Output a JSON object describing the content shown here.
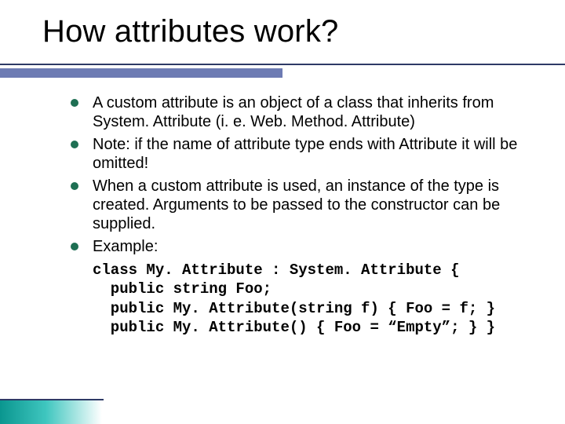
{
  "title": "How attributes work?",
  "bullets": [
    "A custom attribute is an object of a class that inherits from System. Attribute (i. e. Web. Method. Attribute)",
    "Note: if the name of attribute type ends with Attribute it will be omitted!",
    "When a custom attribute is used, an instance of the type is created. Arguments to be passed to the constructor can be supplied.",
    "Example:"
  ],
  "code_lines": [
    "class My. Attribute : System. Attribute {",
    "  public string Foo;",
    "  public My. Attribute(string f) { Foo = f; }",
    "  public My. Attribute() { Foo = “Empty”; } }"
  ]
}
